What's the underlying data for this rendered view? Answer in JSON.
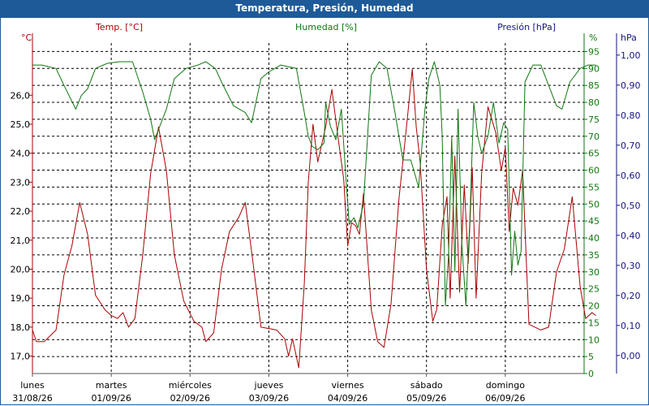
{
  "window": {
    "title": "Temperatura, Presión, Humedad"
  },
  "colors": {
    "temp": "#aa0000",
    "hum": "#117711",
    "pres": "#141480",
    "grid": "#000000",
    "title_bg": "#1f5a98"
  },
  "chart_data": {
    "type": "line",
    "title": "Temperatura, Presión, Humedad",
    "legend_placement": "top",
    "grid": true,
    "axes": {
      "temp": {
        "unit_label": "°C",
        "header": "Temp. [°C]",
        "range": [
          16.4,
          27.8
        ],
        "ticks": [
          "17,0",
          "18,0",
          "19,0",
          "20,0",
          "21,0",
          "22,0",
          "23,0",
          "24,0",
          "25,0",
          "26,0"
        ]
      },
      "hum": {
        "unit_label": "%",
        "header": "Humedad [%]",
        "range": [
          0,
          97.5
        ],
        "ticks": [
          "0",
          "5",
          "10",
          "15",
          "20",
          "25",
          "30",
          "35",
          "40",
          "45",
          "50",
          "55",
          "60",
          "65",
          "70",
          "75",
          "80",
          "85",
          "90",
          "95"
        ]
      },
      "pres": {
        "unit_label": "hPa",
        "header": "Presión [hPa]",
        "range": [
          -0.06,
          1.04
        ],
        "ticks": [
          "0,00",
          "0,10",
          "0,20",
          "0,30",
          "0,40",
          "0,50",
          "0,60",
          "0,70",
          "0,80",
          "0,90",
          "1,00"
        ]
      },
      "x": {
        "range": [
          0,
          7
        ],
        "days": [
          {
            "name": "lunes",
            "date": "31/08/26"
          },
          {
            "name": "martes",
            "date": "01/09/26"
          },
          {
            "name": "miércoles",
            "date": "02/09/26"
          },
          {
            "name": "jueves",
            "date": "03/09/26"
          },
          {
            "name": "viernes",
            "date": "04/09/26"
          },
          {
            "name": "sábado",
            "date": "05/09/26"
          },
          {
            "name": "domingo",
            "date": "06/09/26"
          }
        ]
      }
    },
    "series": [
      {
        "name": "Temp. [°C]",
        "key": "temp",
        "points": [
          [
            0,
            17.9
          ],
          [
            0.05,
            17.5
          ],
          [
            0.15,
            17.5
          ],
          [
            0.3,
            17.9
          ],
          [
            0.4,
            19.8
          ],
          [
            0.5,
            20.8
          ],
          [
            0.6,
            22.3
          ],
          [
            0.7,
            21.2
          ],
          [
            0.8,
            19.1
          ],
          [
            0.92,
            18.6
          ],
          [
            1.0,
            18.4
          ],
          [
            1.08,
            18.3
          ],
          [
            1.15,
            18.5
          ],
          [
            1.22,
            18.0
          ],
          [
            1.3,
            18.3
          ],
          [
            1.4,
            20.5
          ],
          [
            1.5,
            23.3
          ],
          [
            1.6,
            24.9
          ],
          [
            1.7,
            23.4
          ],
          [
            1.8,
            20.5
          ],
          [
            1.92,
            18.9
          ],
          [
            2.05,
            18.2
          ],
          [
            2.15,
            18.0
          ],
          [
            2.2,
            17.5
          ],
          [
            2.3,
            17.8
          ],
          [
            2.4,
            20.0
          ],
          [
            2.5,
            21.3
          ],
          [
            2.62,
            21.8
          ],
          [
            2.7,
            22.3
          ],
          [
            2.8,
            20.2
          ],
          [
            2.9,
            18.0
          ],
          [
            3.1,
            17.9
          ],
          [
            3.2,
            17.6
          ],
          [
            3.25,
            17.0
          ],
          [
            3.3,
            17.6
          ],
          [
            3.38,
            16.6
          ],
          [
            3.45,
            19.5
          ],
          [
            3.5,
            23.0
          ],
          [
            3.56,
            25.0
          ],
          [
            3.62,
            23.7
          ],
          [
            3.72,
            24.9
          ],
          [
            3.8,
            26.2
          ],
          [
            3.88,
            24.5
          ],
          [
            3.95,
            23.1
          ],
          [
            4.0,
            20.8
          ],
          [
            4.05,
            21.6
          ],
          [
            4.1,
            21.5
          ],
          [
            4.15,
            21.2
          ],
          [
            4.2,
            22.6
          ],
          [
            4.3,
            18.6
          ],
          [
            4.38,
            17.5
          ],
          [
            4.46,
            17.3
          ],
          [
            4.55,
            18.8
          ],
          [
            4.65,
            22.4
          ],
          [
            4.75,
            25.0
          ],
          [
            4.82,
            26.9
          ],
          [
            4.87,
            24.9
          ],
          [
            4.92,
            23.7
          ],
          [
            5.0,
            20.0
          ],
          [
            5.08,
            18.2
          ],
          [
            5.13,
            18.6
          ],
          [
            5.2,
            21.5
          ],
          [
            5.26,
            22.5
          ],
          [
            5.3,
            19.0
          ],
          [
            5.36,
            23.9
          ],
          [
            5.42,
            19.2
          ],
          [
            5.48,
            22.9
          ],
          [
            5.53,
            20.2
          ],
          [
            5.58,
            23.5
          ],
          [
            5.63,
            19.0
          ],
          [
            5.7,
            23.3
          ],
          [
            5.78,
            25.6
          ],
          [
            5.88,
            24.7
          ],
          [
            5.95,
            23.4
          ],
          [
            6.0,
            24.2
          ],
          [
            6.05,
            21.3
          ],
          [
            6.1,
            22.8
          ],
          [
            6.16,
            22.2
          ],
          [
            6.22,
            23.4
          ],
          [
            6.3,
            18.1
          ],
          [
            6.45,
            17.9
          ],
          [
            6.55,
            18.0
          ],
          [
            6.65,
            19.9
          ],
          [
            6.75,
            20.7
          ],
          [
            6.85,
            22.5
          ],
          [
            6.95,
            19.4
          ],
          [
            7.02,
            18.3
          ],
          [
            7.1,
            18.5
          ],
          [
            7.15,
            18.4
          ]
        ]
      },
      {
        "name": "Humedad [%]",
        "key": "hum",
        "points": [
          [
            0,
            91
          ],
          [
            0.12,
            91
          ],
          [
            0.3,
            90
          ],
          [
            0.4,
            85
          ],
          [
            0.55,
            78
          ],
          [
            0.62,
            82
          ],
          [
            0.7,
            84
          ],
          [
            0.8,
            90
          ],
          [
            0.95,
            91.5
          ],
          [
            1.1,
            92
          ],
          [
            1.27,
            92
          ],
          [
            1.4,
            83
          ],
          [
            1.5,
            75
          ],
          [
            1.55,
            69
          ],
          [
            1.6,
            72
          ],
          [
            1.7,
            78
          ],
          [
            1.8,
            87
          ],
          [
            1.95,
            90
          ],
          [
            2.1,
            91
          ],
          [
            2.2,
            92
          ],
          [
            2.32,
            90
          ],
          [
            2.4,
            86
          ],
          [
            2.55,
            79
          ],
          [
            2.7,
            77
          ],
          [
            2.78,
            74
          ],
          [
            2.9,
            87
          ],
          [
            3.0,
            89
          ],
          [
            3.15,
            91
          ],
          [
            3.35,
            90
          ],
          [
            3.45,
            77
          ],
          [
            3.5,
            70
          ],
          [
            3.55,
            67
          ],
          [
            3.62,
            66
          ],
          [
            3.7,
            68
          ],
          [
            3.72,
            80
          ],
          [
            3.78,
            73
          ],
          [
            3.85,
            69
          ],
          [
            3.92,
            78
          ],
          [
            3.98,
            57
          ],
          [
            4.02,
            44
          ],
          [
            4.08,
            46
          ],
          [
            4.13,
            43
          ],
          [
            4.2,
            50
          ],
          [
            4.3,
            88
          ],
          [
            4.4,
            92
          ],
          [
            4.5,
            90
          ],
          [
            4.6,
            77
          ],
          [
            4.7,
            63
          ],
          [
            4.8,
            63
          ],
          [
            4.9,
            55
          ],
          [
            4.98,
            78
          ],
          [
            5.03,
            87
          ],
          [
            5.1,
            92
          ],
          [
            5.17,
            85
          ],
          [
            5.2,
            70
          ],
          [
            5.24,
            20
          ],
          [
            5.28,
            35
          ],
          [
            5.32,
            70
          ],
          [
            5.36,
            30
          ],
          [
            5.4,
            78
          ],
          [
            5.45,
            38
          ],
          [
            5.5,
            20
          ],
          [
            5.55,
            45
          ],
          [
            5.6,
            80
          ],
          [
            5.65,
            70
          ],
          [
            5.7,
            65
          ],
          [
            5.78,
            70
          ],
          [
            5.85,
            80
          ],
          [
            5.92,
            68
          ],
          [
            5.98,
            74
          ],
          [
            6.03,
            72
          ],
          [
            6.08,
            29
          ],
          [
            6.12,
            42
          ],
          [
            6.16,
            32
          ],
          [
            6.2,
            36
          ],
          [
            6.25,
            86
          ],
          [
            6.35,
            91
          ],
          [
            6.45,
            91
          ],
          [
            6.55,
            85
          ],
          [
            6.65,
            79
          ],
          [
            6.72,
            78
          ],
          [
            6.82,
            86
          ],
          [
            6.95,
            90
          ],
          [
            7.05,
            91
          ],
          [
            7.15,
            91
          ]
        ]
      }
    ]
  }
}
